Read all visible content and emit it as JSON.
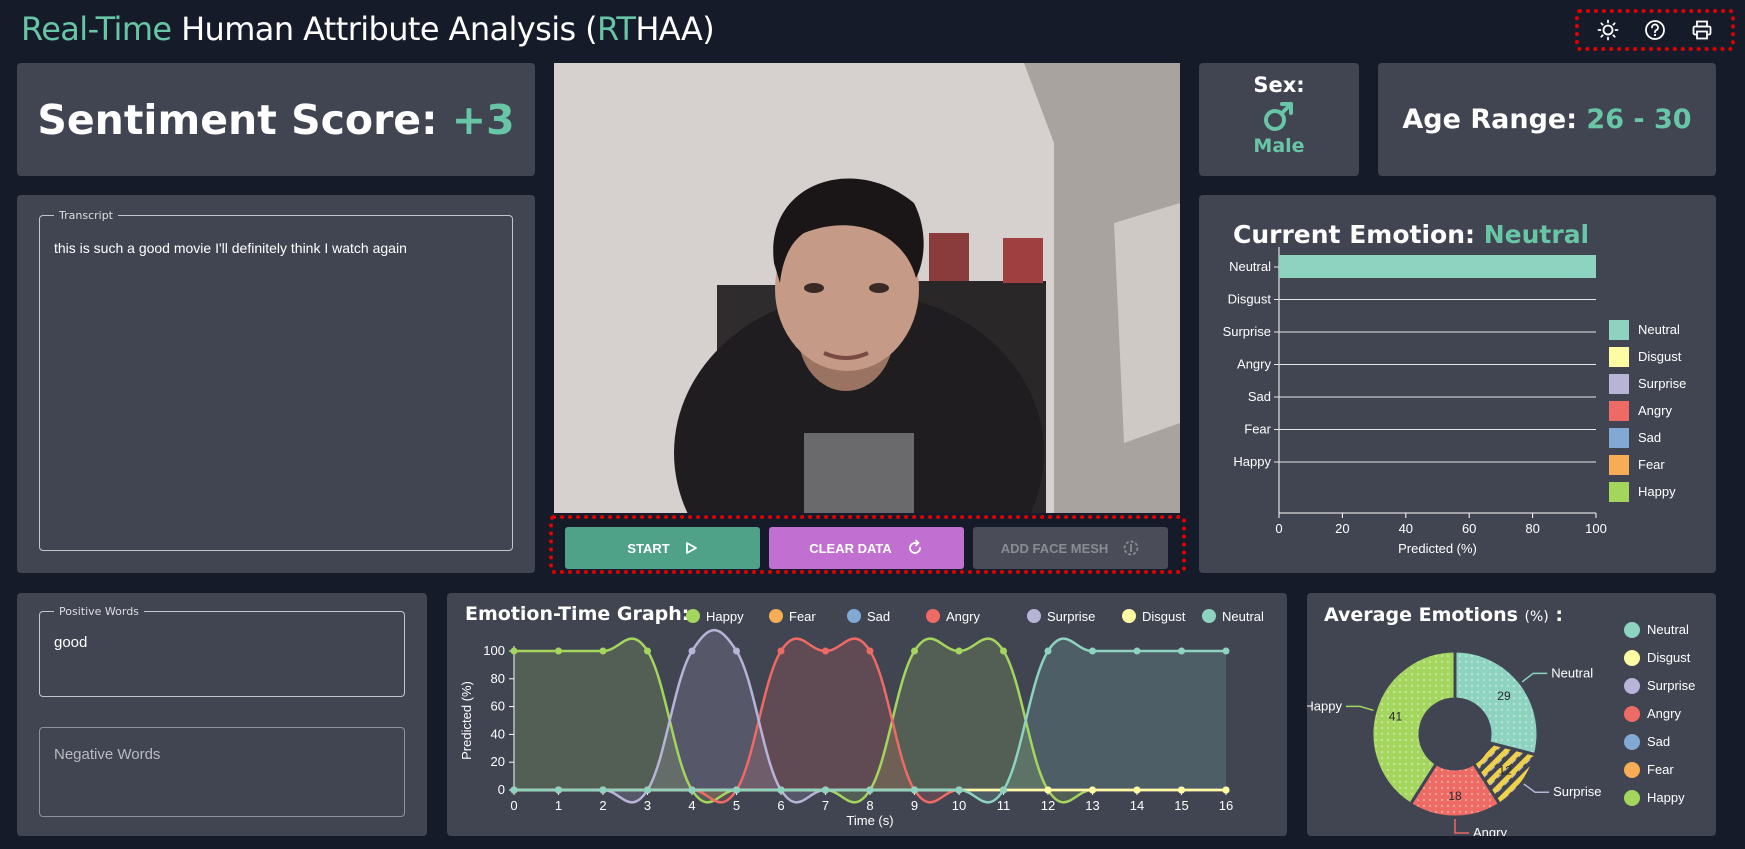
{
  "header": {
    "title_part1": "Real-Time",
    "title_part2": " Human Attribute Analysis (",
    "title_part3": "RT",
    "title_part4": "HAA)",
    "tools": [
      "sun-icon",
      "help-icon",
      "print-icon"
    ]
  },
  "sentiment": {
    "label": "Sentiment Score:",
    "value": "+3"
  },
  "transcript": {
    "legend": "Transcript",
    "text": "this is such a good movie I'll definitely think I watch again"
  },
  "sex": {
    "label": "Sex:",
    "icon": "male-icon",
    "value": "Male"
  },
  "age": {
    "label": "Age Range:",
    "value": "26 - 30"
  },
  "video": {
    "alt": "webcam-feed"
  },
  "controls": {
    "start": "START",
    "clear": "CLEAR DATA",
    "mesh": "ADD FACE MESH"
  },
  "current_emotion": {
    "label": "Current Emotion:",
    "value": "Neutral"
  },
  "positive_words": {
    "legend": "Positive Words",
    "text": "good"
  },
  "negative_words": {
    "placeholder": "Negative Words"
  },
  "emotion_time_graph": {
    "title": "Emotion-Time Graph:"
  },
  "average_emotions": {
    "title": "Average Emotions",
    "unit": "(%)",
    "colon": ":"
  },
  "colors": {
    "Happy": "#a4d65e",
    "Fear": "#f6ad55",
    "Sad": "#82a9d4",
    "Angry": "#ee6a64",
    "Surprise": "#b8b4d8",
    "Disgust": "#fefca2",
    "Neutral": "#8dd3c0",
    "accent": "#68c6a6"
  },
  "chart_data": [
    {
      "type": "bar",
      "orientation": "horizontal",
      "categories": [
        "Neutral",
        "Disgust",
        "Surprise",
        "Angry",
        "Sad",
        "Fear",
        "Happy"
      ],
      "values": [
        100,
        0,
        0,
        0,
        0,
        0,
        0
      ],
      "xlabel": "Predicted (%)",
      "xlim": [
        0,
        100
      ],
      "xticks": [
        0,
        20,
        40,
        60,
        80,
        100
      ],
      "legend": [
        "Neutral",
        "Disgust",
        "Surprise",
        "Angry",
        "Sad",
        "Fear",
        "Happy"
      ],
      "legend_position": "right"
    },
    {
      "type": "line",
      "x": [
        0,
        1,
        2,
        3,
        4,
        5,
        6,
        7,
        8,
        9,
        10,
        11,
        12,
        13,
        14,
        15,
        16
      ],
      "xlabel": "Time (s)",
      "ylabel": "Predicted (%)",
      "ylim": [
        0,
        100
      ],
      "yticks": [
        0,
        20,
        40,
        60,
        80,
        100
      ],
      "legend_position": "top",
      "series": [
        {
          "name": "Happy",
          "values": [
            100,
            100,
            100,
            100,
            0,
            0,
            0,
            0,
            0,
            100,
            100,
            100,
            0,
            0,
            0,
            0,
            0
          ]
        },
        {
          "name": "Fear",
          "values": [
            0,
            0,
            0,
            0,
            0,
            0,
            0,
            0,
            0,
            0,
            0,
            0,
            0,
            0,
            0,
            0,
            0
          ]
        },
        {
          "name": "Sad",
          "values": [
            0,
            0,
            0,
            0,
            0,
            0,
            0,
            0,
            0,
            0,
            0,
            0,
            0,
            0,
            0,
            0,
            0
          ]
        },
        {
          "name": "Angry",
          "values": [
            0,
            0,
            0,
            0,
            0,
            0,
            100,
            100,
            100,
            0,
            0,
            0,
            0,
            0,
            0,
            0,
            0
          ]
        },
        {
          "name": "Surprise",
          "values": [
            0,
            0,
            0,
            0,
            100,
            100,
            0,
            0,
            0,
            0,
            0,
            0,
            0,
            0,
            0,
            0,
            0
          ]
        },
        {
          "name": "Disgust",
          "values": [
            0,
            0,
            0,
            0,
            0,
            0,
            0,
            0,
            0,
            0,
            0,
            0,
            0,
            0,
            0,
            0,
            0
          ]
        },
        {
          "name": "Neutral",
          "values": [
            0,
            0,
            0,
            0,
            0,
            0,
            0,
            0,
            0,
            0,
            0,
            0,
            100,
            100,
            100,
            100,
            100
          ]
        }
      ]
    },
    {
      "type": "pie",
      "variant": "doughnut",
      "labels": [
        "Neutral",
        "Disgust",
        "Surprise",
        "Angry",
        "Sad",
        "Fear",
        "Happy"
      ],
      "values": [
        29,
        0,
        12,
        18,
        0,
        0,
        41
      ],
      "legend": [
        "Neutral",
        "Disgust",
        "Surprise",
        "Angry",
        "Sad",
        "Fear",
        "Happy"
      ],
      "legend_position": "right",
      "callouts": [
        "Neutral",
        "Surprise",
        "Angry",
        "Happy"
      ]
    }
  ]
}
